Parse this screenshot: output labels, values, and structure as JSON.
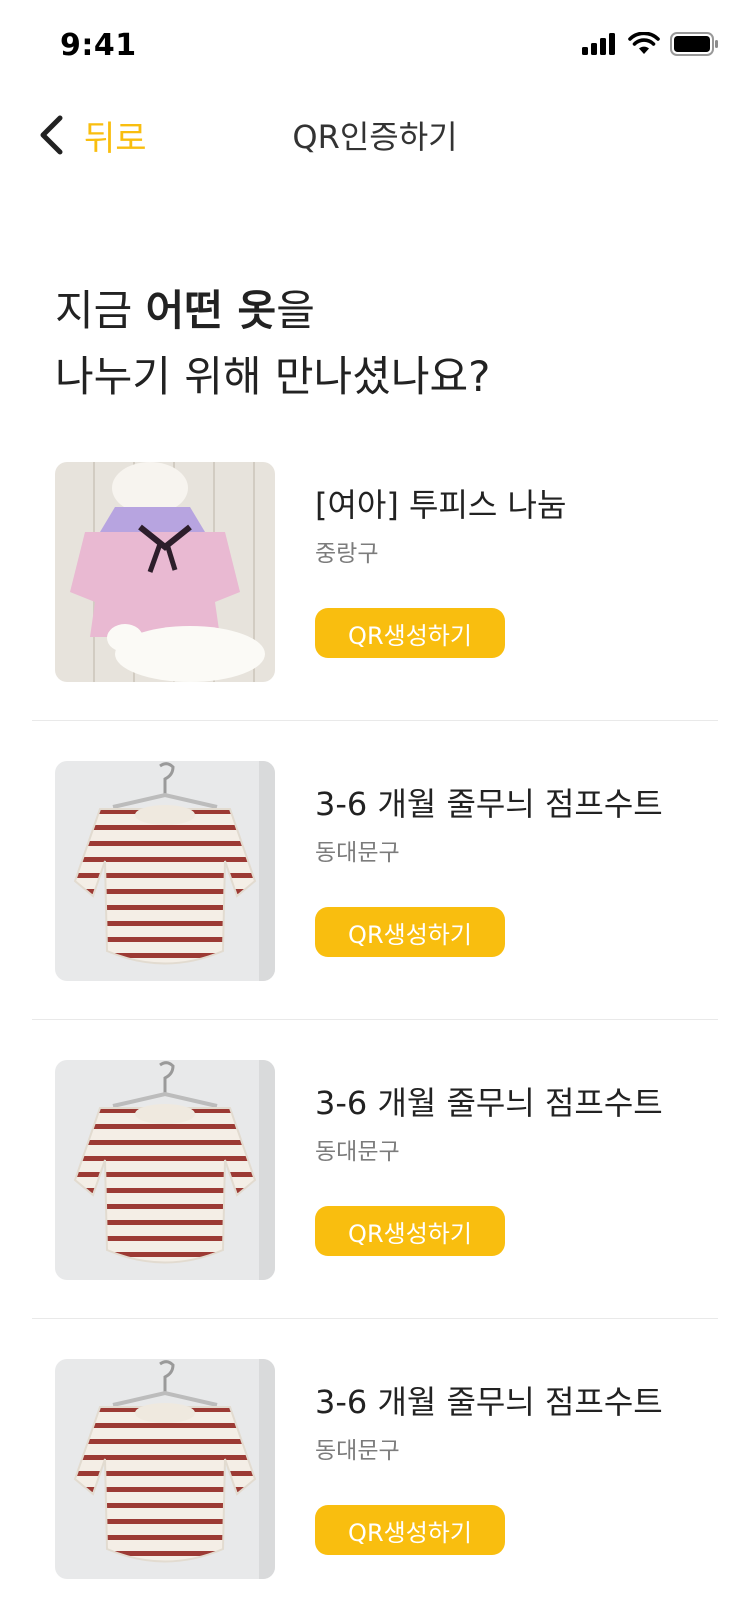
{
  "status_bar": {
    "time": "9:41"
  },
  "nav": {
    "back_label": "뒤로",
    "title": "QR인증하기"
  },
  "heading": {
    "prefix": "지금 ",
    "bold1": "어떤 옷",
    "middle": "을",
    "line2": "나누기 위해 만나셨나요?"
  },
  "items": [
    {
      "title": "[여아] 투피스 나눔",
      "region": "중랑구",
      "button": "QR생성하기",
      "image_icon": "pink-dress-photo"
    },
    {
      "title": "3-6 개월 줄무늬 점프수트",
      "region": "동대문구",
      "button": "QR생성하기",
      "image_icon": "striped-bodysuit-photo"
    },
    {
      "title": "3-6 개월 줄무늬 점프수트",
      "region": "동대문구",
      "button": "QR생성하기",
      "image_icon": "striped-bodysuit-photo"
    },
    {
      "title": "3-6 개월 줄무늬 점프수트",
      "region": "동대문구",
      "button": "QR생성하기",
      "image_icon": "striped-bodysuit-photo"
    }
  ],
  "colors": {
    "accent": "#F9BE0F",
    "text": "#222222",
    "subtext": "#7c7c7c"
  }
}
